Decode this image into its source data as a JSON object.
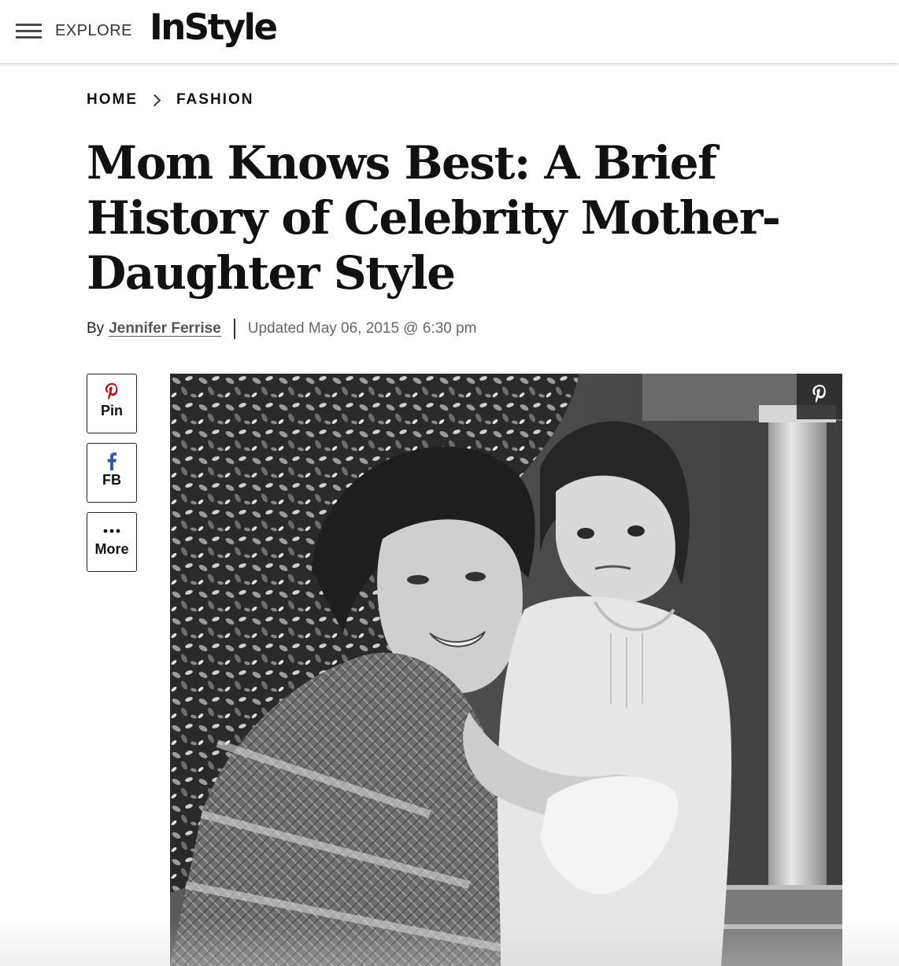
{
  "header": {
    "menu_icon": "hamburger-icon",
    "explore_label": "EXPLORE",
    "logo_text": "InStyle"
  },
  "breadcrumb": {
    "items": [
      "HOME",
      "FASHION"
    ],
    "separator_icon": "chevron-right-icon"
  },
  "article": {
    "title": "Mom Knows Best: A Brief History of Celebrity Mother-Daughter Style",
    "byline_prefix": "By",
    "author": "Jennifer Ferrise",
    "updated": "Updated May 06, 2015 @ 6:30 pm"
  },
  "share": {
    "pin_label": "Pin",
    "fb_label": "FB",
    "more_label": "More",
    "pin_icon": "pinterest-icon",
    "fb_icon": "facebook-icon",
    "more_icon": "ellipsis-icon",
    "pin_color": "#bd081c",
    "fb_color": "#3b5998"
  },
  "hero": {
    "overlay_icon": "pinterest-icon"
  }
}
